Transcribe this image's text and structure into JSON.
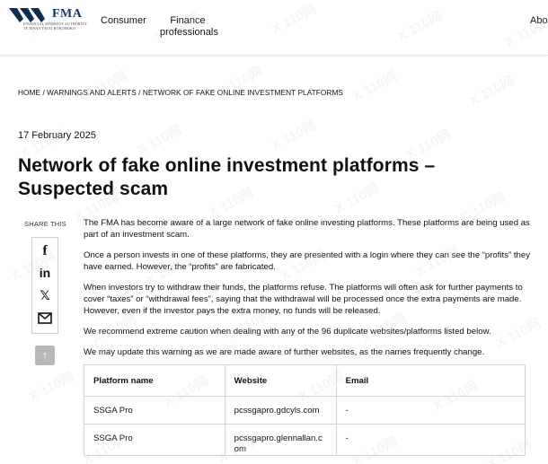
{
  "header": {
    "logo_text": "FMA",
    "logo_subtitle": "FINANCIAL MARKETS AUTHORITY\nTE MANA TATAI HOKOHOKO",
    "nav": {
      "consumer": "Consumer",
      "finance_professionals": "Finance professionals",
      "about": "About"
    }
  },
  "breadcrumb": {
    "home": "HOME",
    "section": "WARNINGS AND ALERTS",
    "current": "NETWORK OF FAKE ONLINE INVESTMENT PLATFORMS",
    "separator": " / "
  },
  "article": {
    "date": "17 February 2025",
    "title": "Network of fake online investment platforms – Suspected scam",
    "paragraphs": [
      "The FMA has become aware of a large network of fake online investing platforms. These platforms are being used as part of an investment scam.",
      "Once a person invests in one of these platforms, they are presented with a login where they can see the “profits” they have earned. However, the “profits” are fabricated.",
      "When investors try to withdraw their funds, the platforms refuse. The platforms will often ask for further payments to cover “taxes” or “withdrawal fees”, saying that the withdrawal will be processed once the extra payments are made. However, even if the investor pays the extra money, no funds will be released.",
      "We recommend extreme caution when dealing with any of the 96 duplicate websites/platforms listed below.",
      "We may update this warning as we are made aware of further websites, as the names frequently change."
    ]
  },
  "share": {
    "label": "SHARE THIS",
    "icons": [
      "facebook-icon",
      "linkedin-icon",
      "x-icon",
      "mail-icon"
    ],
    "facebook_glyph": "f",
    "linkedin_glyph": "in",
    "x_glyph": "𝕏",
    "back_to_top_glyph": "↑"
  },
  "table": {
    "headers": [
      "Platform name",
      "Website",
      "Email"
    ],
    "rows": [
      {
        "platform": "SSGA Pro",
        "website": "pcssgapro.gdcyls.com",
        "email": "-"
      },
      {
        "platform": "SSGA Pro",
        "website": "pcssgapro.glennallan.c om",
        "email": "-"
      }
    ]
  },
  "watermark": {
    "text": "X 110网"
  },
  "colors": {
    "brand_navy": "#0d2d52",
    "back_to_top_bg": "#b8b8b8",
    "table_border": "#d4d4d4"
  }
}
